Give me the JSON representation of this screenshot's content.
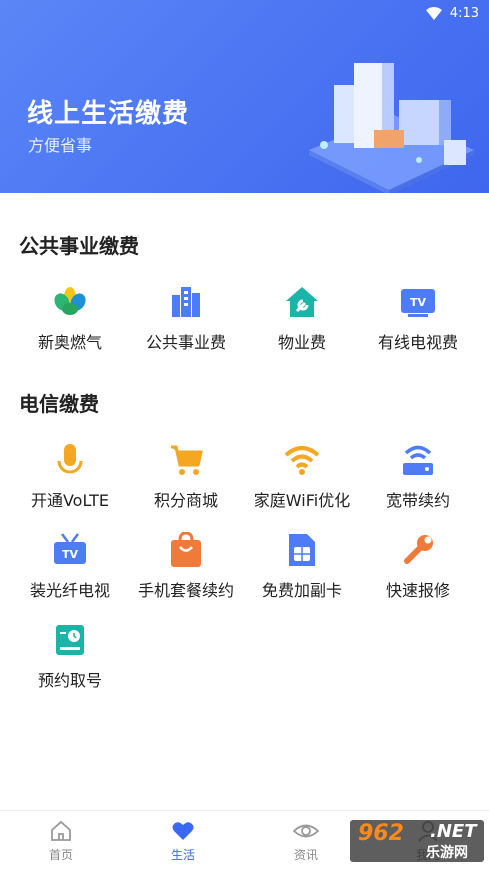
{
  "status_bar": {
    "time": "4:13"
  },
  "banner": {
    "title": "线上生活缴费",
    "subtitle": "方便省事"
  },
  "sections": {
    "public": {
      "title": "公共事业缴费",
      "items": [
        {
          "label": "新奥燃气",
          "icon": "gas-logo-icon"
        },
        {
          "label": "公共事业费",
          "icon": "building-icon"
        },
        {
          "label": "物业费",
          "icon": "house-wrench-icon"
        },
        {
          "label": "有线电视费",
          "icon": "tv-icon"
        }
      ]
    },
    "telecom": {
      "title": "电信缴费",
      "items": [
        {
          "label": "开通VoLTE",
          "icon": "microphone-icon"
        },
        {
          "label": "积分商城",
          "icon": "shopping-cart-icon"
        },
        {
          "label": "家庭WiFi优化",
          "icon": "wifi-icon"
        },
        {
          "label": "宽带续约",
          "icon": "router-icon"
        },
        {
          "label": "装光纤电视",
          "icon": "fiber-tv-icon"
        },
        {
          "label": "手机套餐续约",
          "icon": "shopping-bag-icon"
        },
        {
          "label": "免费加副卡",
          "icon": "sim-card-icon"
        },
        {
          "label": "快速报修",
          "icon": "wrench-icon"
        },
        {
          "label": "预约取号",
          "icon": "queue-ticket-icon"
        }
      ]
    }
  },
  "bottom_nav": {
    "items": [
      {
        "label": "首页",
        "icon": "home-icon"
      },
      {
        "label": "生活",
        "icon": "heart-icon",
        "active": true
      },
      {
        "label": "资讯",
        "icon": "eye-icon"
      },
      {
        "label": "我的",
        "icon": "user-icon"
      }
    ]
  },
  "watermark": {
    "brand": "962",
    "net": ".NET",
    "site": "乐游网"
  },
  "colors": {
    "accent": "#3b68f0",
    "orange": "#f5a623",
    "red_orange": "#f07a3a",
    "teal": "#1bb5a8"
  }
}
